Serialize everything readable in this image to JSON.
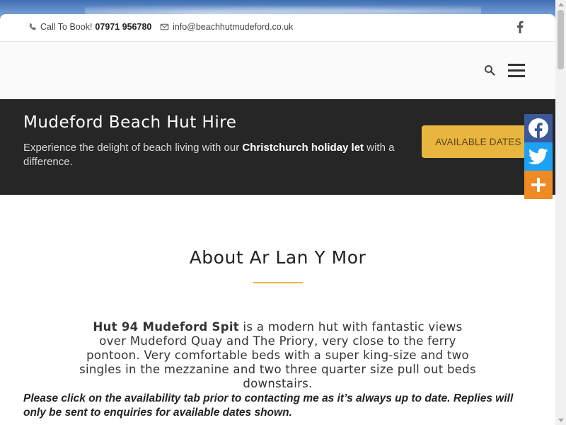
{
  "topbar": {
    "call_label": "Call To Book!",
    "phone": "07971 956780",
    "email": "info@beachhutmudeford.co.uk",
    "facebook_icon": "facebook-icon"
  },
  "navbar": {
    "search_icon": "search-icon",
    "menu_icon": "hamburger-menu-icon"
  },
  "hero": {
    "title": "Mudeford Beach Hut Hire",
    "subtitle_pre": "Experience the delight of beach living with our ",
    "subtitle_bold": "Christchurch holiday let",
    "subtitle_post": " with a difference.",
    "button_label": "AVAILABLE DATES",
    "button_color": "#e8b63f"
  },
  "about": {
    "heading": "About Ar Lan Y Mor",
    "desc_bold": "Hut 94 Mudeford Spit",
    "desc_rest": " is a modern hut with fantastic views over  Mudeford Quay and The Priory, very close to the ferry pontoon. Very comfortable beds with a super king-size and two singles in the mezzanine and two three quarter size pull out beds downstairs.",
    "notice": "Please click on the availability tab prior to contacting me as it’s always up to date. Replies will only be sent to enquiries for available dates shown."
  },
  "share": {
    "facebook_color": "#3b5998",
    "twitter_color": "#1da1f2",
    "more_color": "#f08a24"
  }
}
